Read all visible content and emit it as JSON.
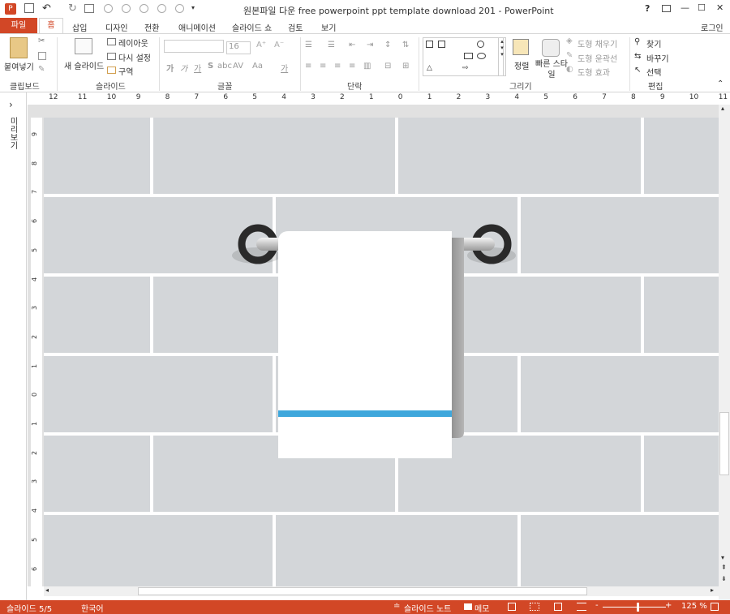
{
  "titlebar": {
    "title": "원본파일 다운 free powerpoint ppt template download 201 - PowerPoint",
    "help": "?",
    "minimize": "—",
    "maximize": "☐",
    "close": "✕"
  },
  "tabs": {
    "file": "파일",
    "home": "홈",
    "insert": "삽입",
    "design": "디자인",
    "transitions": "전환",
    "animations": "애니메이션",
    "slideshow": "슬라이드 쇼",
    "review": "검토",
    "view": "보기",
    "login": "로그인"
  },
  "ribbon": {
    "clipboard": {
      "paste": "붙여넣기",
      "group": "클립보드"
    },
    "slides": {
      "new_slide": "새 슬라이드",
      "layout": "레이아웃",
      "reset": "다시 설정",
      "section": "구역",
      "group": "슬라이드"
    },
    "font": {
      "font_name": "",
      "font_size": "16",
      "bold": "가",
      "italic": "가",
      "underline": "가",
      "strike": "S",
      "spacing": "AV",
      "case": "Aa",
      "clear": "가",
      "group": "글꼴"
    },
    "paragraph": {
      "group": "단락"
    },
    "drawing": {
      "arrange": "정렬",
      "quick_styles": "빠른 스타일",
      "fill": "도형 채우기",
      "outline": "도형 윤곽선",
      "effects": "도형 효과",
      "group": "그리기"
    },
    "editing": {
      "find": "찾기",
      "replace": "바꾸기",
      "select": "선택",
      "group": "편집"
    }
  },
  "ruler_h": [
    "12",
    "11",
    "10",
    "9",
    "8",
    "7",
    "6",
    "5",
    "4",
    "3",
    "2",
    "1",
    "0",
    "1",
    "2",
    "3",
    "4",
    "5",
    "6",
    "7",
    "8",
    "9",
    "10",
    "11"
  ],
  "ruler_v": [
    "9",
    "8",
    "7",
    "6",
    "5",
    "4",
    "3",
    "2",
    "1",
    "0",
    "1",
    "2",
    "3",
    "4",
    "5",
    "6"
  ],
  "thumb_pane": {
    "label": "미리보기",
    "toggle": "›"
  },
  "status": {
    "slide": "슬라이드 5/5",
    "language": "한국어",
    "notes": "슬라이드 노트",
    "comments": "메모",
    "zoom": "125 %",
    "zoom_minus": "-",
    "zoom_plus": "+"
  },
  "colors": {
    "accent": "#d24726",
    "stripe": "#3ea7dc",
    "tile": "#d3d6d9",
    "ring": "#2a2a2a"
  },
  "zoom_level_fraction": 0.55
}
